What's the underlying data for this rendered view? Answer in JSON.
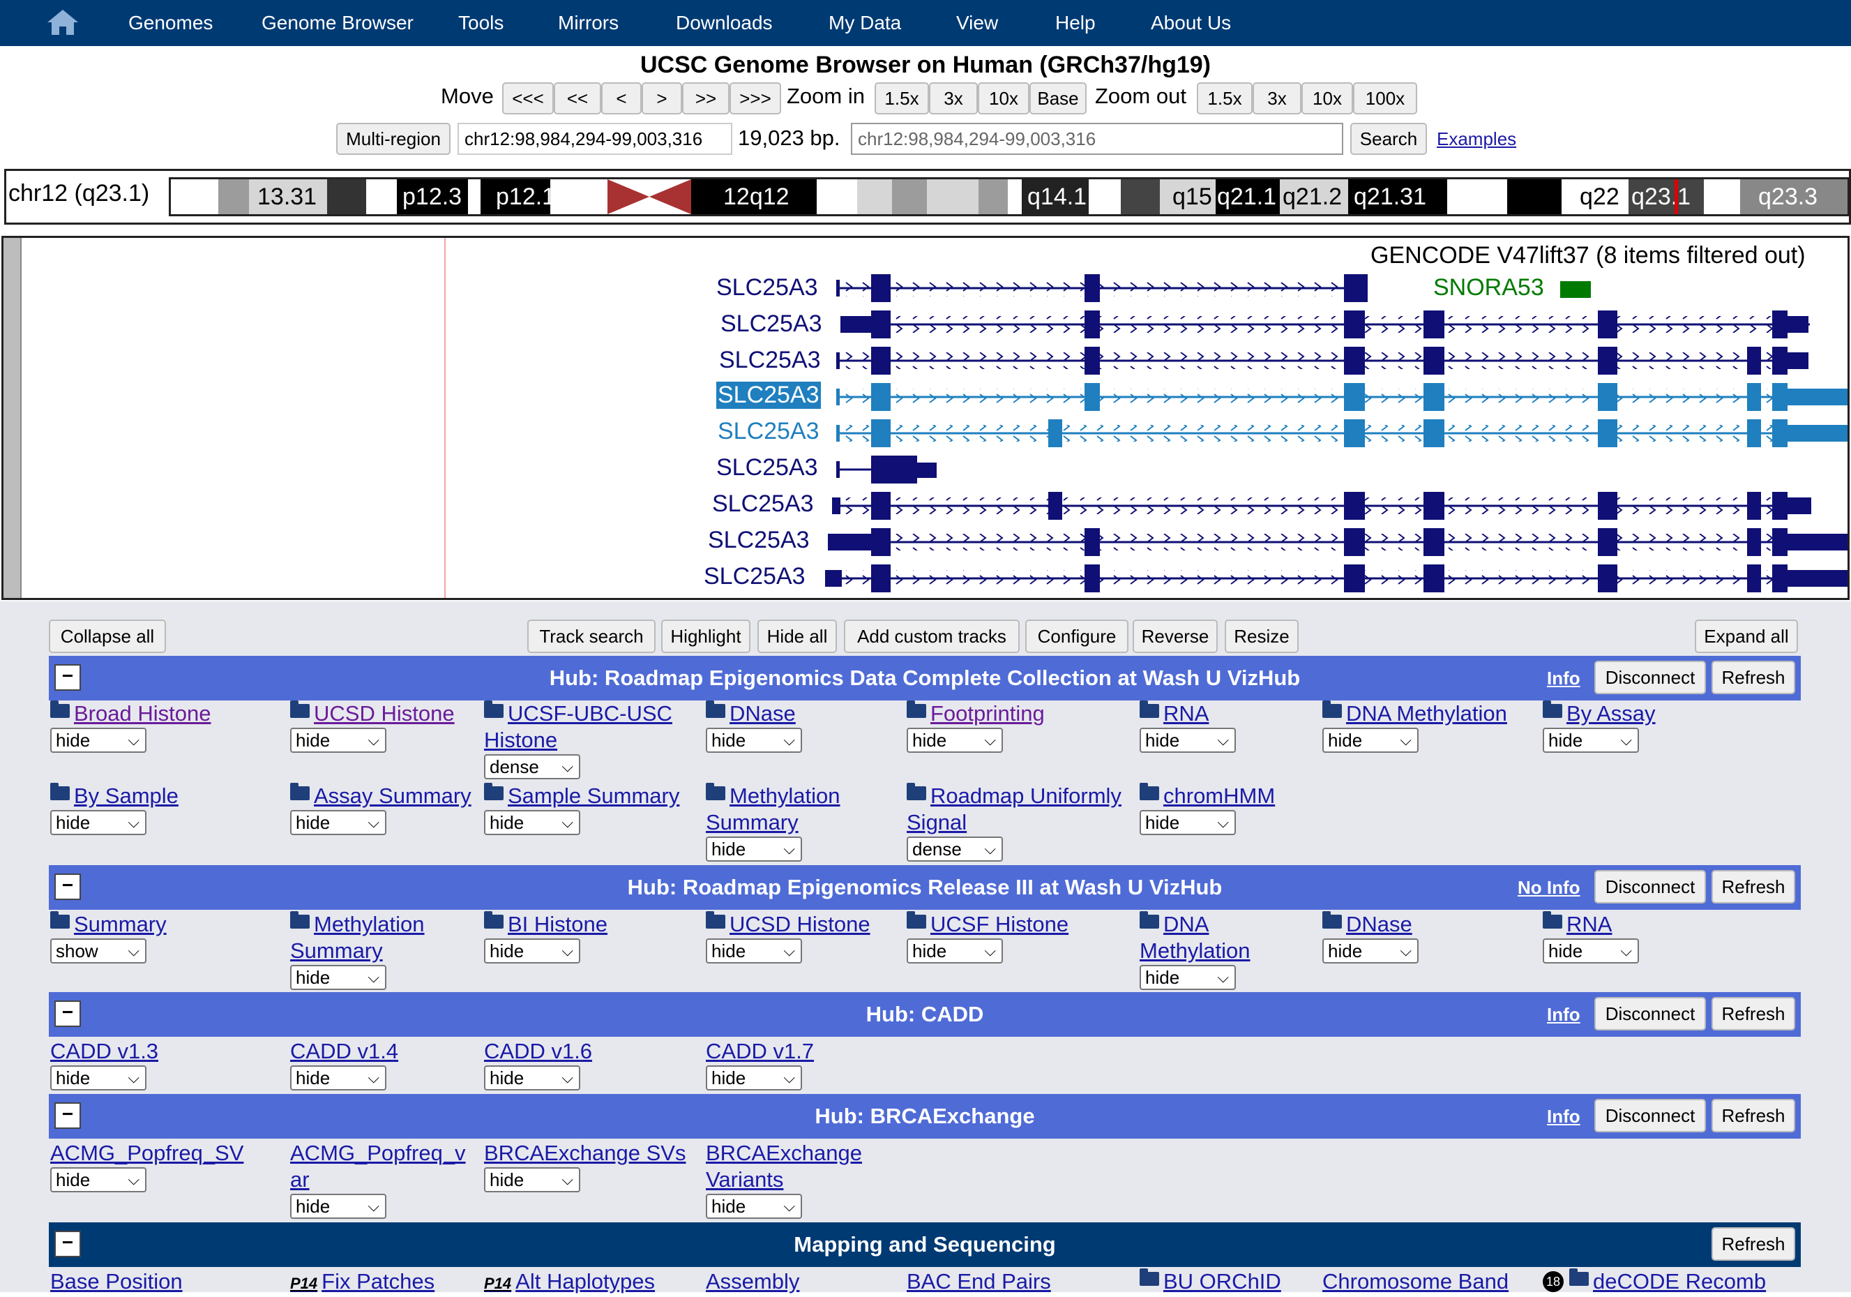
{
  "nav": {
    "items": [
      "Genomes",
      "Genome Browser",
      "Tools",
      "Mirrors",
      "Downloads",
      "My Data",
      "View",
      "Help",
      "About Us"
    ]
  },
  "title": "UCSC Genome Browser on Human (GRCh37/hg19)",
  "move": {
    "label": "Move",
    "buttons": [
      "<<<",
      "<<",
      "<",
      ">",
      ">>",
      ">>>"
    ],
    "zoom_in_label": "Zoom in",
    "zoom_in_buttons": [
      "1.5x",
      "3x",
      "10x",
      "Base"
    ],
    "zoom_out_label": "Zoom out",
    "zoom_out_buttons": [
      "1.5x",
      "3x",
      "10x",
      "100x"
    ]
  },
  "position": {
    "multi_region": "Multi-region",
    "current": "chr12:98,984,294-99,003,316",
    "size": "19,023 bp.",
    "search_placeholder": "chr12:98,984,294-99,003,316",
    "search_button": "Search",
    "examples": "Examples"
  },
  "ideogram": {
    "chrom_label": "chr12 (q23.1)",
    "bands": [
      "13.31",
      "p12.3",
      "p12.1",
      "12q12",
      "q14.1",
      "q15",
      "q21.1",
      "q21.2",
      "q21.31",
      "q22",
      "q23.1",
      "q23.3"
    ]
  },
  "track": {
    "title": "GENCODE V47lift37 (8 items filtered out)",
    "genes": [
      "SLC25A3",
      "SLC25A3",
      "SLC25A3",
      "SLC25A3",
      "SLC25A3",
      "SLC25A3",
      "SLC25A3",
      "SLC25A3",
      "SLC25A3"
    ],
    "snora": "SNORA53"
  },
  "controls": {
    "collapse_all": "Collapse all",
    "track_search": "Track search",
    "highlight": "Highlight",
    "hide_all": "Hide all",
    "add_custom": "Add custom tracks",
    "configure": "Configure",
    "reverse": "Reverse",
    "resize": "Resize",
    "expand_all": "Expand all"
  },
  "hubs": [
    {
      "title": "Hub: Roadmap Epigenomics Data Complete Collection at Wash U VizHub",
      "info": "Info",
      "disconnect": "Disconnect",
      "refresh": "Refresh",
      "tracks": [
        {
          "l1": "Broad Histone",
          "v": "hide"
        },
        {
          "l1": "UCSD Histone",
          "v": "hide"
        },
        {
          "l1": "UCSF-UBC-USC",
          "l2": "Histone",
          "v": "dense"
        },
        {
          "l1": "DNase",
          "v": "hide"
        },
        {
          "l1": "Footprinting",
          "v": "hide"
        },
        {
          "l1": "RNA",
          "v": "hide"
        },
        {
          "l1": "DNA Methylation",
          "v": "hide"
        },
        {
          "l1": "By Assay",
          "v": "hide"
        },
        {
          "l1": "By Sample",
          "v": "hide"
        },
        {
          "l1": "Assay Summary",
          "v": "hide"
        },
        {
          "l1": "Sample Summary",
          "v": "hide"
        },
        {
          "l1": "Methylation",
          "l2": "Summary",
          "v": "hide"
        },
        {
          "l1": "Roadmap Uniformly",
          "l2": "Signal",
          "v": "dense"
        },
        {
          "l1": "chromHMM",
          "v": "hide"
        }
      ]
    },
    {
      "title": "Hub: Roadmap Epigenomics Release III at Wash U VizHub",
      "info": "No Info",
      "disconnect": "Disconnect",
      "refresh": "Refresh",
      "tracks": [
        {
          "l1": "Summary",
          "v": "show"
        },
        {
          "l1": "Methylation",
          "l2": "Summary",
          "v": "hide"
        },
        {
          "l1": "BI Histone",
          "v": "hide"
        },
        {
          "l1": "UCSD Histone",
          "v": "hide"
        },
        {
          "l1": "UCSF Histone",
          "v": "hide"
        },
        {
          "l1": "DNA",
          "l2": "Methylation",
          "v": "hide"
        },
        {
          "l1": "DNase",
          "v": "hide"
        },
        {
          "l1": "RNA",
          "v": "hide"
        }
      ]
    },
    {
      "title": "Hub: CADD",
      "info": "Info",
      "disconnect": "Disconnect",
      "refresh": "Refresh",
      "tracks": [
        {
          "l1": "CADD v1.3",
          "v": "hide"
        },
        {
          "l1": "CADD v1.4",
          "v": "hide"
        },
        {
          "l1": "CADD v1.6",
          "v": "hide"
        },
        {
          "l1": "CADD v1.7",
          "v": "hide"
        }
      ]
    },
    {
      "title": "Hub: BRCAExchange",
      "info": "Info",
      "disconnect": "Disconnect",
      "refresh": "Refresh",
      "tracks": [
        {
          "l1": "ACMG_Popfreq_SV",
          "v": "hide"
        },
        {
          "l1": "ACMG_Popfreq_v",
          "l2": "ar",
          "v": "hide"
        },
        {
          "l1": "BRCAExchange SVs",
          "v": "hide"
        },
        {
          "l1": "BRCAExchange",
          "l2": "Variants",
          "v": "hide"
        }
      ]
    }
  ],
  "mapping": {
    "title": "Mapping and Sequencing",
    "refresh": "Refresh",
    "p14": "P14",
    "badge": "18",
    "tracks": [
      "Base Position",
      "Fix Patches",
      "Alt Haplotypes",
      "Assembly",
      "BAC End Pairs",
      "BU ORChID",
      "Chromosome Band",
      "deCODE Recomb"
    ]
  },
  "colors": {
    "nav": "#003a73",
    "hub_header": "#4f6bd6",
    "mapping_header": "#003a73",
    "gene_dark": "#0f0f75",
    "gene_light": "#1f7fbf",
    "snora": "#007a00",
    "position_marker": "#e00000"
  }
}
